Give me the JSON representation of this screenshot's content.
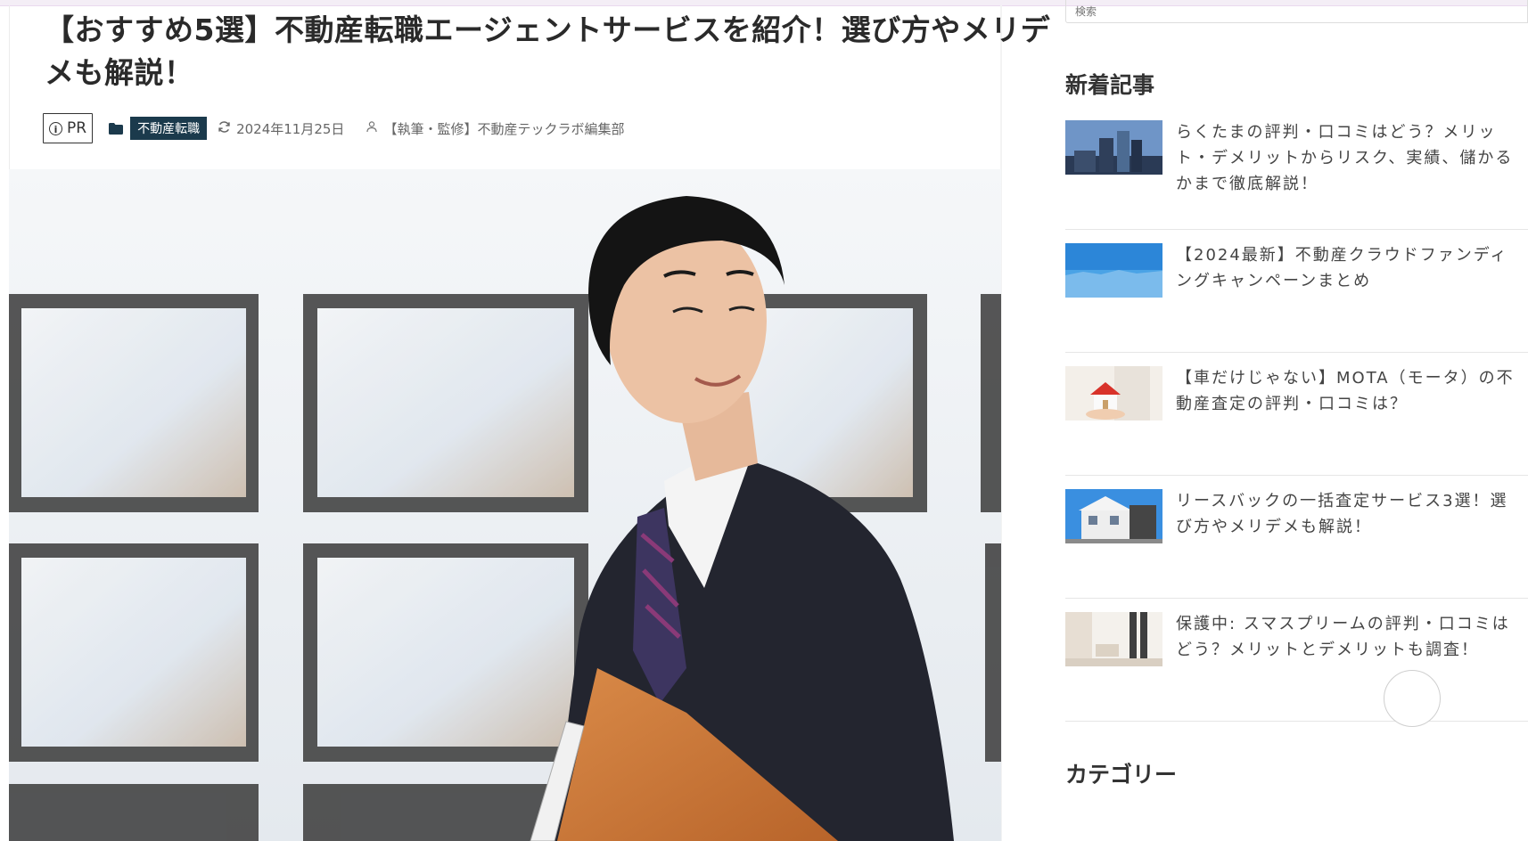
{
  "article": {
    "title": "【おすすめ5選】不動産転職エージェントサービスを紹介！選び方やメリデメも解説！",
    "pr_label": "PR",
    "category": "不動産転職",
    "date": "2024年11月25日",
    "author": "【執筆・監修】不動産テックラボ編集部"
  },
  "sidebar": {
    "search_placeholder": "検索",
    "recent_heading": "新着記事",
    "recent_posts": [
      {
        "title": "らくたまの評判・口コミはどう？メリット・デメリットからリスク、実績、儲かるかまで徹底解説！"
      },
      {
        "title": "【2024最新】不動産クラウドファンディングキャンペーンまとめ"
      },
      {
        "title": "【車だけじゃない】MOTA（モータ）の不動産査定の評判・口コミは？"
      },
      {
        "title": "リースバックの一括査定サービス3選！選び方やメリデメも解説！"
      },
      {
        "title": "保護中: スマスプリームの評判・口コミはどう？メリットとデメリットも調査！"
      }
    ],
    "category_heading": "カテゴリー"
  },
  "colors": {
    "category_tag_bg": "#1b3a4c",
    "title_text": "#2a2a2a"
  }
}
